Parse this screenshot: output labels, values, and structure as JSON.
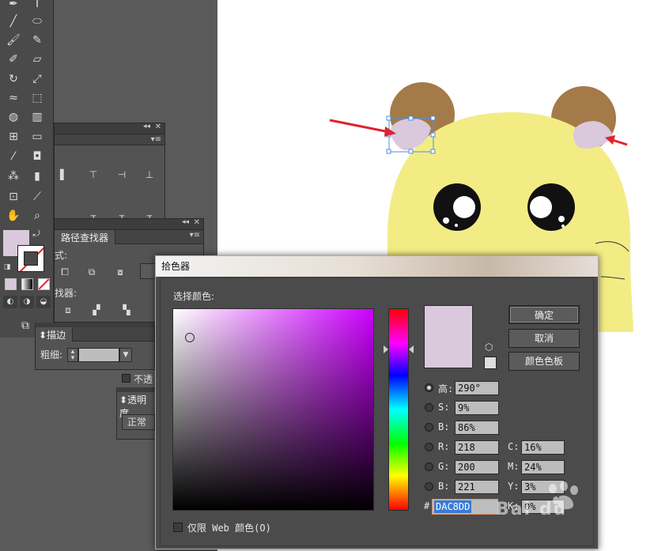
{
  "panels": {
    "pathfinder": {
      "tab": "路径查找器",
      "shape_mode_partial": "式:",
      "pathfinder_partial": "找器:"
    },
    "stroke": {
      "tab": "描边",
      "weight_label": "粗细:"
    },
    "opacity_partial": "不透",
    "transparency": {
      "tab": "透明度",
      "mode": "正常"
    }
  },
  "picker": {
    "title": "拾色器",
    "select_color_label": "选择颜色:",
    "buttons": {
      "ok": "确定",
      "cancel": "取消",
      "swatches": "颜色色板"
    },
    "fields": {
      "H": {
        "label": "高:",
        "value": "290°"
      },
      "S": {
        "label": "S:",
        "value": "9%"
      },
      "B": {
        "label": "B:",
        "value": "86%"
      },
      "R": {
        "label": "R:",
        "value": "218"
      },
      "G": {
        "label": "G:",
        "value": "200"
      },
      "B2": {
        "label": "B:",
        "value": "221"
      },
      "C": {
        "label": "C:",
        "value": "16%"
      },
      "M": {
        "label": "M:",
        "value": "24%"
      },
      "Y": {
        "label": "Y:",
        "value": "3%"
      },
      "K": {
        "label": "K:",
        "value": "0%"
      }
    },
    "hex_prefix": "#",
    "hex": "DAC8DD",
    "web_only_label": "仅限 Web 颜色(O)"
  },
  "colors": {
    "current_color": "#dac8dd",
    "hamster_body": "#f3ec85",
    "hamster_ear": "#a47a48",
    "arrow": "#e0232d"
  },
  "icons": [
    "pen-icon",
    "type-icon",
    "line-icon",
    "ellipse-icon",
    "brush-icon",
    "pencil-icon",
    "blob-brush-icon",
    "eraser-icon",
    "rotate-icon",
    "scale-icon",
    "warp-icon",
    "free-transform-icon",
    "shape-builder-icon",
    "graph-icon",
    "mesh-icon",
    "gradient-icon",
    "eyedropper-icon",
    "blend-icon",
    "symbol-sprayer-icon",
    "column-graph-icon",
    "artboard-icon",
    "slice-icon",
    "hand-icon",
    "zoom-icon",
    "swap-icon",
    "cube-icon",
    "baidu-paw-icon"
  ],
  "watermark": "Bai du"
}
